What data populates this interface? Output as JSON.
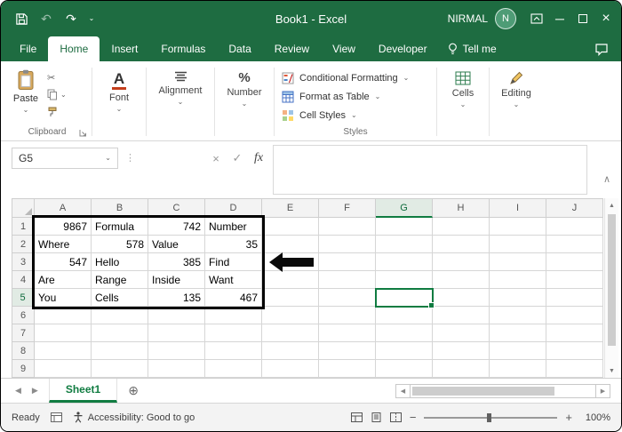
{
  "window": {
    "title": "Book1 - Excel",
    "user_name": "NIRMAL",
    "avatar_initial": "N"
  },
  "ribbon_tabs": {
    "items": [
      {
        "label": "File"
      },
      {
        "label": "Home"
      },
      {
        "label": "Insert"
      },
      {
        "label": "Formulas"
      },
      {
        "label": "Data"
      },
      {
        "label": "Review"
      },
      {
        "label": "View"
      },
      {
        "label": "Developer"
      }
    ],
    "active_tab": "Home",
    "tell_me": "Tell me"
  },
  "ribbon": {
    "paste_label": "Paste",
    "clipboard_label": "Clipboard",
    "font_label": "Font",
    "alignment_label": "Alignment",
    "number_label": "Number",
    "conditional_formatting_label": "Conditional Formatting",
    "format_as_table_label": "Format as Table",
    "cell_styles_label": "Cell Styles",
    "styles_label": "Styles",
    "cells_label": "Cells",
    "editing_label": "Editing"
  },
  "formula_bar": {
    "name_box": "G5",
    "fx_label": "fx",
    "formula_value": ""
  },
  "grid": {
    "columns": [
      "A",
      "B",
      "C",
      "D",
      "E",
      "F",
      "G",
      "H",
      "I",
      "J"
    ],
    "rows": [
      "1",
      "2",
      "3",
      "4",
      "5",
      "6",
      "7",
      "8",
      "9"
    ],
    "selected_cell": "G5",
    "selected_column": "G",
    "selected_row": "5",
    "data_range_outlined": "A1:D5",
    "data": [
      [
        "9867",
        "Formula",
        "742",
        "Number"
      ],
      [
        "Where",
        "578",
        "Value",
        "35"
      ],
      [
        "547",
        "Hello",
        "385",
        "Find"
      ],
      [
        "Are",
        "Range",
        "Inside",
        "Want"
      ],
      [
        "You",
        "Cells",
        "135",
        "467"
      ],
      [],
      [],
      [],
      []
    ]
  },
  "sheet_bar": {
    "tab": "Sheet1"
  },
  "status_bar": {
    "mode": "Ready",
    "accessibility": "Accessibility: Good to go",
    "zoom_level": "100%"
  },
  "colors": {
    "excel_green": "#1E6C41",
    "accent_green": "#107C41",
    "avatar_green": "#4E9C76",
    "font_underline_red": "#C43E1C",
    "annotation_black": "#000000"
  },
  "icons": {
    "chevron_down": "⌄",
    "chevron_up": "∧",
    "undo": "↶",
    "redo": "↷",
    "close": "×",
    "minimize": "─",
    "cancel": "×",
    "enter": "✓",
    "cut": "✂",
    "left_arrow": "◀",
    "right_arrow": "▶",
    "up_arrow": "▲",
    "down_arrow": "▼",
    "add_sheet": "⊕",
    "minus": "−",
    "plus": "+",
    "percent": "%",
    "font_a": "A",
    "dots": "⋮"
  }
}
